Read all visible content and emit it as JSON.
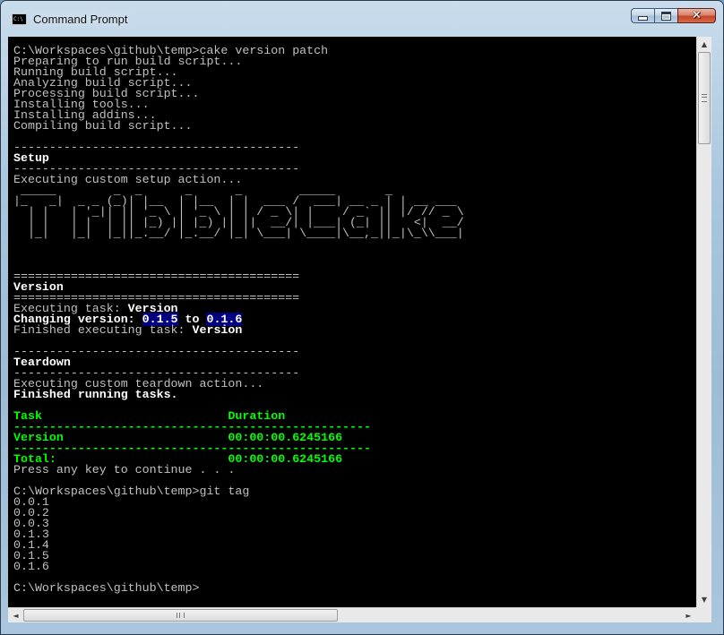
{
  "window": {
    "title": "Command Prompt",
    "icon_text": "C:\\",
    "min_glyph": "",
    "max_glyph": "",
    "close_glyph": "✕"
  },
  "icons": {
    "app": "command-prompt-icon",
    "scroll_up": "▲",
    "scroll_down": "▼",
    "scroll_left": "◄",
    "scroll_right": "►"
  },
  "colors": {
    "console_bg": "#000000",
    "console_fg": "#c0c0c0",
    "bright_white": "#ffffff",
    "green": "#00ff00",
    "highlight_bg": "#000080"
  },
  "console": {
    "lines": [
      "C:\\Workspaces\\github\\temp>cake version patch",
      "Preparing to run build script...",
      "Running build script...",
      "Analyzing build script...",
      "Processing build script...",
      "Installing tools...",
      "Installing addins...",
      "Compiling build script...",
      "",
      "----------------------------------------",
      "Setup",
      "----------------------------------------",
      "Executing custom setup action...",
      " _____        _  _      _      _        _____       _         ",
      "|_   _|  _ _ (_)| |__  | |__  | |  ___ /  ___| __ _ | | __ ___ ",
      "  | |   | '_|| || '_ \\ | '_ \\ | | / _ \\| |    / _` || |/ // _ \\",
      "  | |   | |  | || |_) || |_) || ||  __/| |___| (_| ||   <|  __/",
      "  |_|   |_|  |_||_.__/ |_.__/ |_| \\___| \\____|\\__,_||_|\\_\\\\___|",
      "",
      "",
      "",
      "========================================",
      "Version",
      "========================================",
      "Executing task: Version",
      "Changing version: 0.1.5 to 0.1.6",
      "Finished executing task: Version",
      "",
      "----------------------------------------",
      "Teardown",
      "----------------------------------------",
      "Executing custom teardown action...",
      "Finished running tasks.",
      "",
      "Task                          Duration",
      "--------------------------------------------------",
      "Version                       00:00:00.6245166",
      "--------------------------------------------------",
      "Total:                        00:00:00.6245166",
      "Press any key to continue . . .",
      "",
      "C:\\Workspaces\\github\\temp>git tag",
      "0.0.1",
      "0.0.2",
      "0.0.3",
      "0.1.3",
      "0.1.4",
      "0.1.5",
      "0.1.6",
      "",
      "C:\\Workspaces\\github\\temp>"
    ]
  }
}
